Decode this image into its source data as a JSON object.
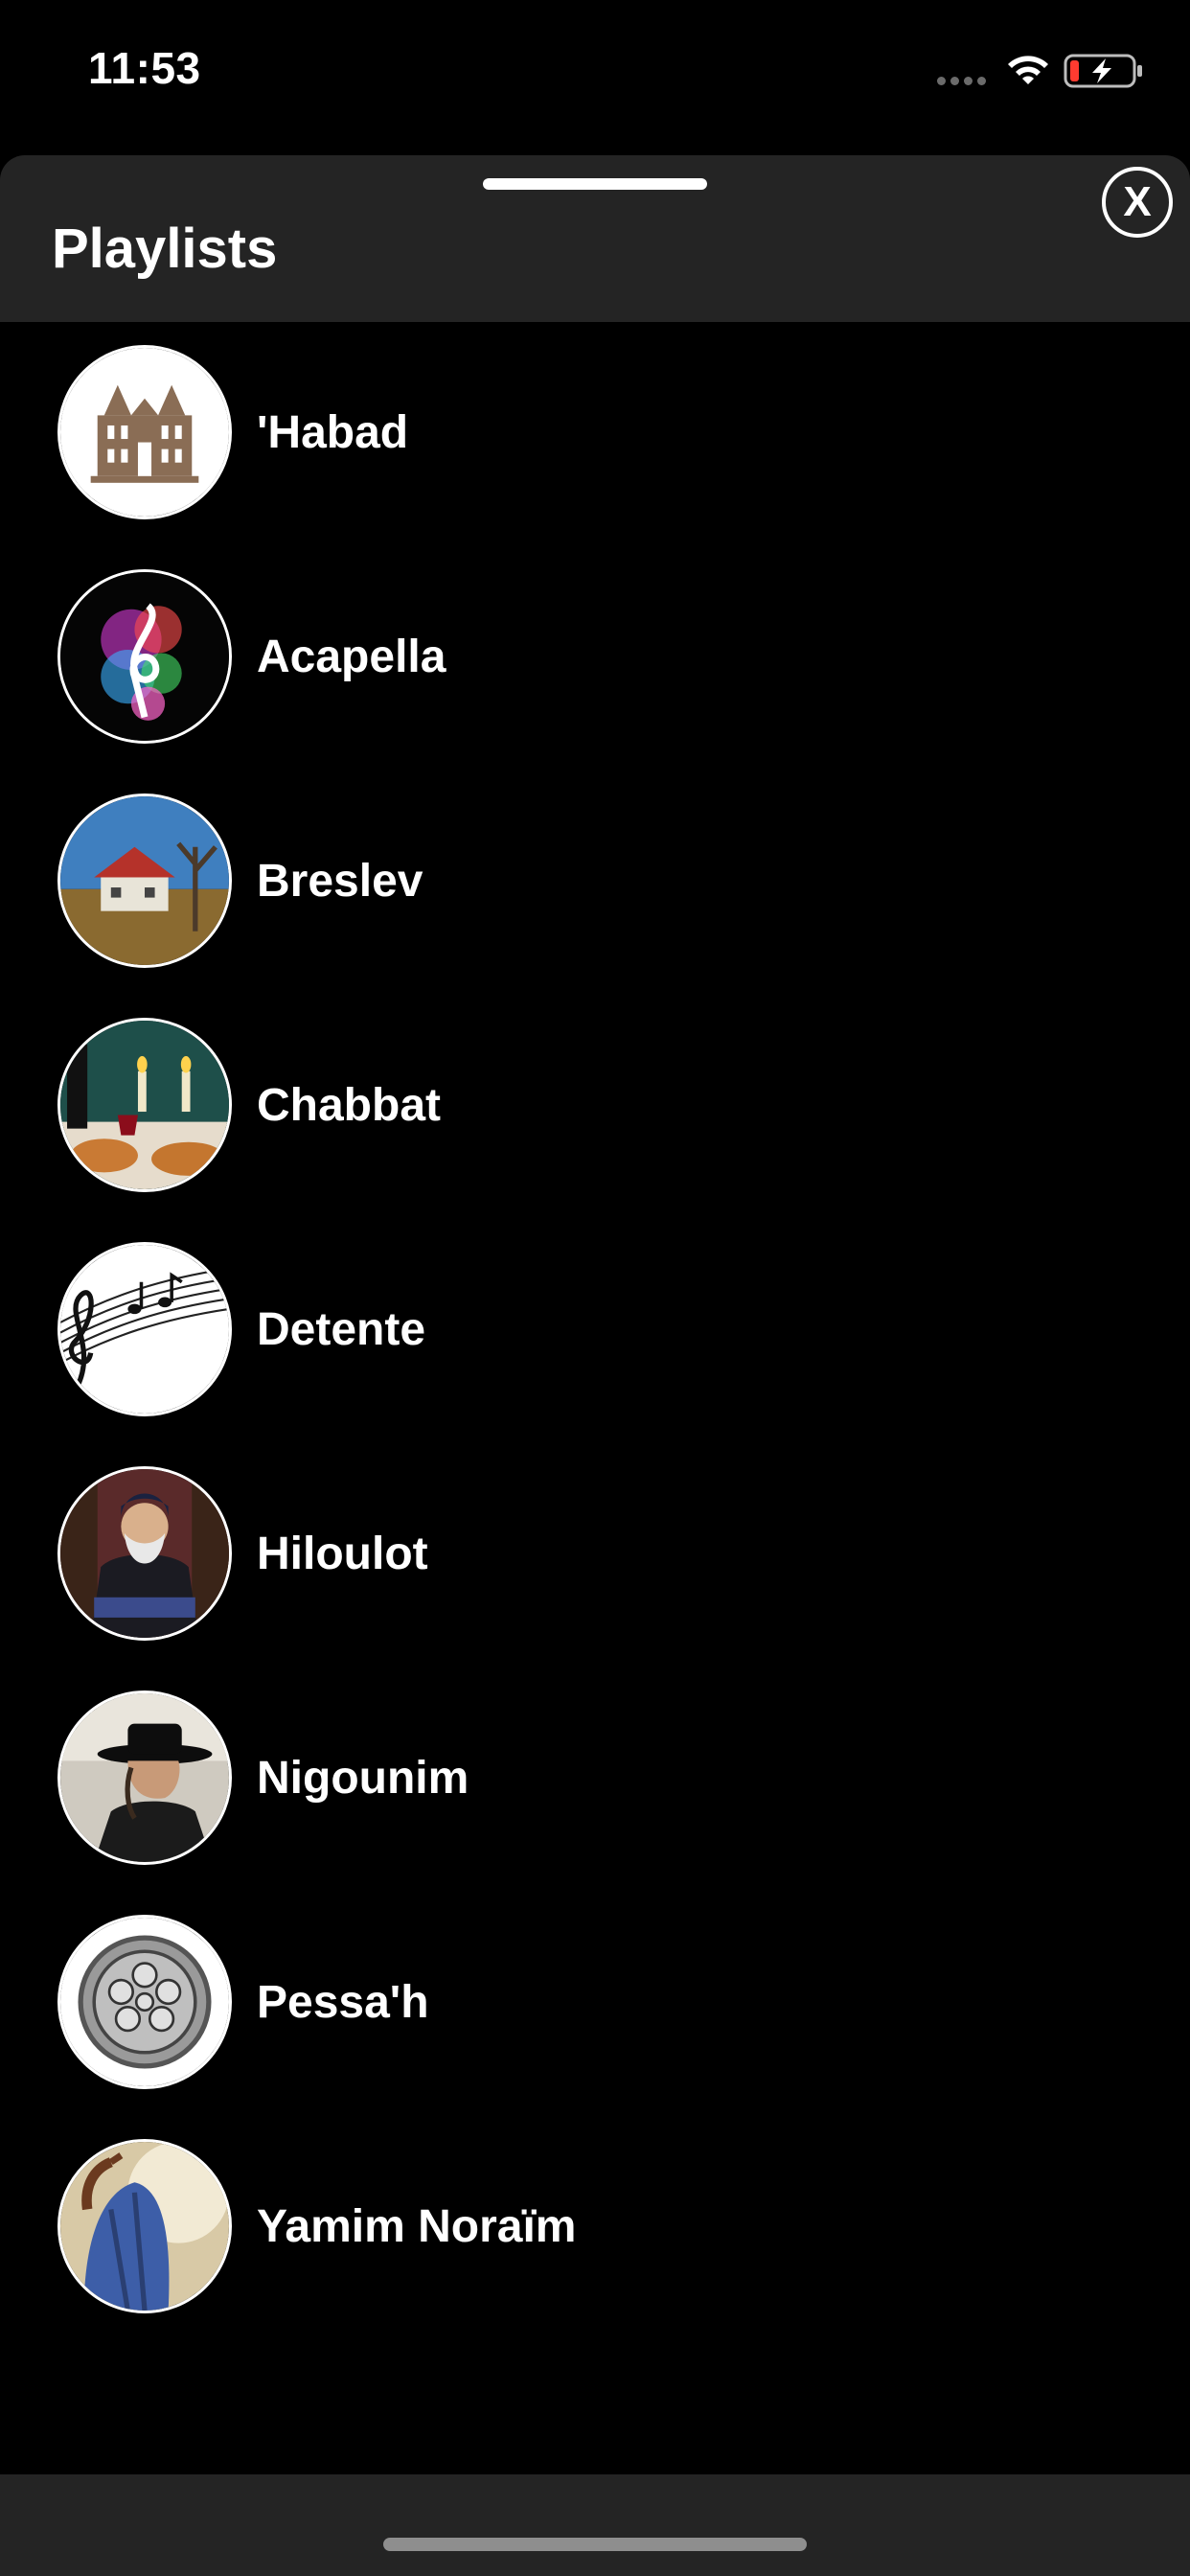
{
  "status_bar": {
    "time": "11:53",
    "icons": [
      "signal-dots-icon",
      "wifi-icon",
      "battery-charging-icon"
    ]
  },
  "sheet": {
    "title": "Playlists",
    "close_label": "X"
  },
  "playlists": [
    {
      "label": "'Habad",
      "thumb": "building-icon"
    },
    {
      "label": "Acapella",
      "thumb": "treble-clef-smoke-icon"
    },
    {
      "label": "Breslev",
      "thumb": "house-landscape-icon"
    },
    {
      "label": "Chabbat",
      "thumb": "shabbat-candles-icon"
    },
    {
      "label": "Detente",
      "thumb": "music-notes-icon"
    },
    {
      "label": "Hiloulot",
      "thumb": "rabbi-portrait-icon"
    },
    {
      "label": "Nigounim",
      "thumb": "hat-man-icon"
    },
    {
      "label": "Pessa'h",
      "thumb": "seder-plate-icon"
    },
    {
      "label": "Yamim Noraïm",
      "thumb": "shofar-tallit-icon"
    }
  ],
  "colors": {
    "background": "#000000",
    "header": "#242424",
    "text": "#ffffff"
  }
}
